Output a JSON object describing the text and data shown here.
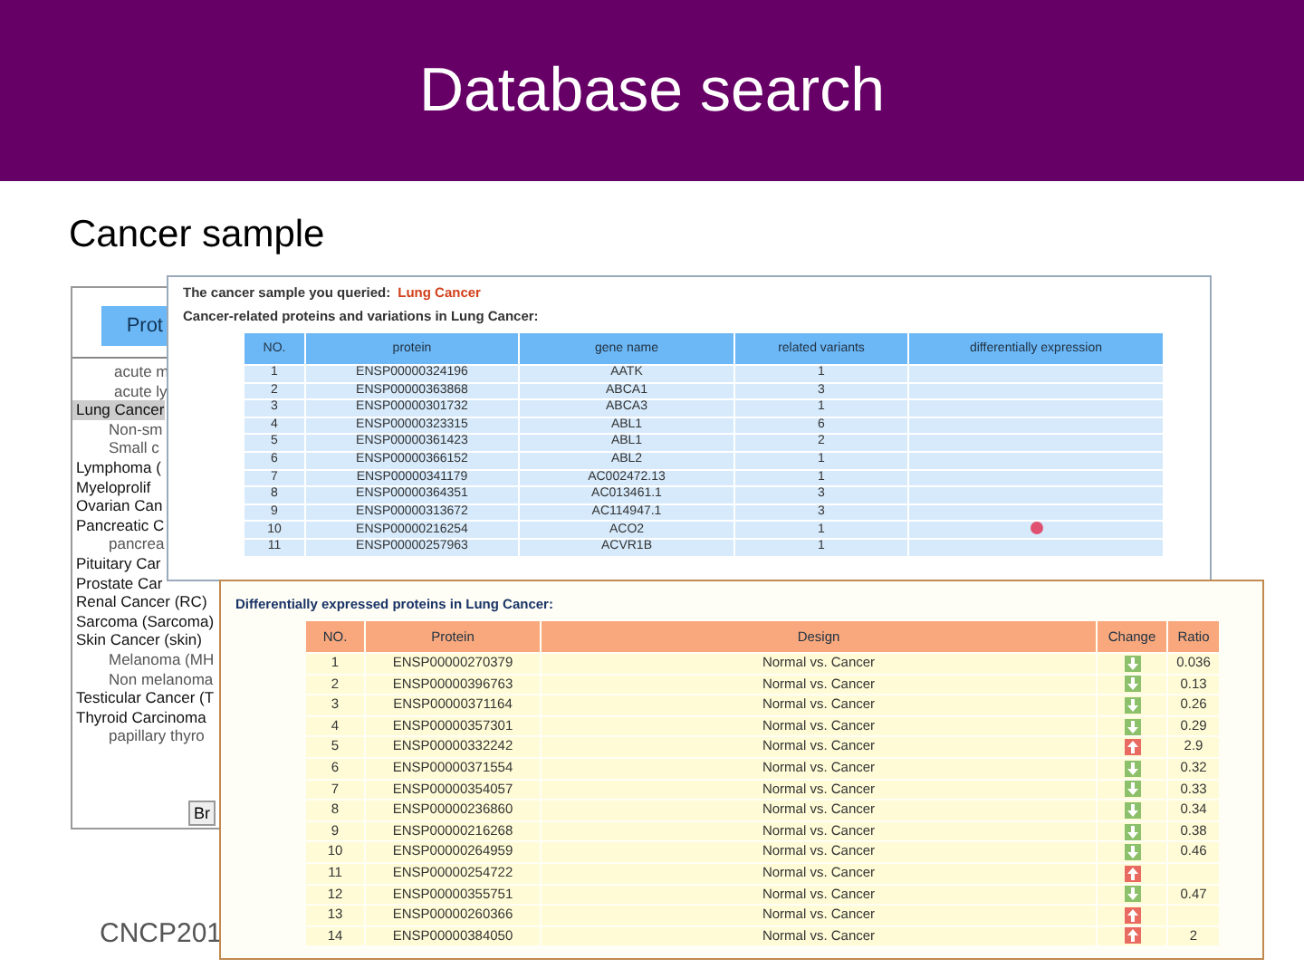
{
  "slide": {
    "title": "Database search",
    "subtitle": "Cancer sample",
    "footer": "CNCP201"
  },
  "list_panel": {
    "header": "Prot",
    "button": "Br",
    "continued": [
      {
        "text": "acute m",
        "selected": false
      },
      {
        "text": "acute ly",
        "selected": false
      }
    ],
    "items": [
      {
        "text": "Lung Cancer",
        "selected": true,
        "children": [
          {
            "text": "Non-sm",
            "selected": false
          },
          {
            "text": "Small c",
            "selected": false
          }
        ]
      },
      {
        "text": "Lymphoma (",
        "selected": false
      },
      {
        "text": "Myeloprolif",
        "selected": false
      },
      {
        "text": "Ovarian Can",
        "selected": false
      },
      {
        "text": "Pancreatic C",
        "selected": false,
        "children": [
          {
            "text": "pancrea",
            "selected": false
          }
        ]
      },
      {
        "text": "Pituitary Car",
        "selected": false
      },
      {
        "text": "Prostate Car",
        "selected": false
      },
      {
        "text": "Renal Cancer (RC)",
        "selected": false
      },
      {
        "text": "Sarcoma (Sarcoma)",
        "selected": false
      },
      {
        "text": "Skin Cancer (skin)",
        "selected": false,
        "children": [
          {
            "text": "Melanoma (MH",
            "selected": false
          },
          {
            "text": "Non melanoma",
            "selected": false
          }
        ]
      },
      {
        "text": "Testicular Cancer (T",
        "selected": false
      },
      {
        "text": "Thyroid Carcinoma",
        "selected": false,
        "children": [
          {
            "text": "papillary thyro",
            "selected": false
          }
        ]
      }
    ]
  },
  "query_panel": {
    "query_label": "The cancer sample you queried:",
    "query_value": "Lung Cancer",
    "heading": "Cancer-related proteins and variations in Lung Cancer:",
    "columns": [
      "NO.",
      "protein",
      "gene name",
      "related variants",
      "differentially expression"
    ],
    "rows": [
      {
        "no": "1",
        "protein": "ENSP00000324196",
        "gene": "AATK",
        "variants": "1",
        "flagged": false
      },
      {
        "no": "2",
        "protein": "ENSP00000363868",
        "gene": "ABCA1",
        "variants": "3",
        "flagged": false
      },
      {
        "no": "3",
        "protein": "ENSP00000301732",
        "gene": "ABCA3",
        "variants": "1",
        "flagged": false
      },
      {
        "no": "4",
        "protein": "ENSP00000323315",
        "gene": "ABL1",
        "variants": "6",
        "flagged": false
      },
      {
        "no": "5",
        "protein": "ENSP00000361423",
        "gene": "ABL1",
        "variants": "2",
        "flagged": false
      },
      {
        "no": "6",
        "protein": "ENSP00000366152",
        "gene": "ABL2",
        "variants": "1",
        "flagged": false
      },
      {
        "no": "7",
        "protein": "ENSP00000341179",
        "gene": "AC002472.13",
        "variants": "1",
        "flagged": false
      },
      {
        "no": "8",
        "protein": "ENSP00000364351",
        "gene": "AC013461.1",
        "variants": "3",
        "flagged": false
      },
      {
        "no": "9",
        "protein": "ENSP00000313672",
        "gene": "AC114947.1",
        "variants": "3",
        "flagged": false
      },
      {
        "no": "10",
        "protein": "ENSP00000216254",
        "gene": "ACO2",
        "variants": "1",
        "flagged": true
      },
      {
        "no": "11",
        "protein": "ENSP00000257963",
        "gene": "ACVR1B",
        "variants": "1",
        "flagged": false
      }
    ]
  },
  "expression_panel": {
    "heading": "Differentially expressed proteins in Lung Cancer:",
    "columns": [
      "NO.",
      "Protein",
      "Design",
      "Change",
      "Ratio"
    ],
    "rows": [
      {
        "no": "1",
        "protein": "ENSP00000270379",
        "design": "Normal vs. Cancer",
        "kind": "down",
        "ratio": "0.036"
      },
      {
        "no": "2",
        "protein": "ENSP00000396763",
        "design": "Normal vs. Cancer",
        "kind": "down",
        "ratio": "0.13"
      },
      {
        "no": "3",
        "protein": "ENSP00000371164",
        "design": "Normal vs. Cancer",
        "kind": "down",
        "ratio": "0.26"
      },
      {
        "no": "4",
        "protein": "ENSP00000357301",
        "design": "Normal vs. Cancer",
        "kind": "down",
        "ratio": "0.29"
      },
      {
        "no": "5",
        "protein": "ENSP00000332242",
        "design": "Normal vs. Cancer",
        "kind": "up",
        "ratio": "2.9"
      },
      {
        "no": "6",
        "protein": "ENSP00000371554",
        "design": "Normal vs. Cancer",
        "kind": "down",
        "ratio": "0.32"
      },
      {
        "no": "7",
        "protein": "ENSP00000354057",
        "design": "Normal vs. Cancer",
        "kind": "down",
        "ratio": "0.33"
      },
      {
        "no": "8",
        "protein": "ENSP00000236860",
        "design": "Normal vs. Cancer",
        "kind": "down",
        "ratio": "0.34"
      },
      {
        "no": "9",
        "protein": "ENSP00000216268",
        "design": "Normal vs. Cancer",
        "kind": "down",
        "ratio": "0.38"
      },
      {
        "no": "10",
        "protein": "ENSP00000264959",
        "design": "Normal vs. Cancer",
        "kind": "down",
        "ratio": "0.46"
      },
      {
        "no": "11",
        "protein": "ENSP00000254722",
        "design": "Normal vs. Cancer",
        "kind": "up"
      },
      {
        "no": "12",
        "protein": "ENSP00000355751",
        "design": "Normal vs. Cancer",
        "kind": "down",
        "ratio": "0.47"
      },
      {
        "no": "13",
        "protein": "ENSP00000260366",
        "design": "Normal vs. Cancer",
        "kind": "up"
      },
      {
        "no": "14",
        "protein": "ENSP00000384050",
        "design": "Normal vs. Cancer",
        "kind": "up",
        "ratio": "2"
      }
    ]
  }
}
